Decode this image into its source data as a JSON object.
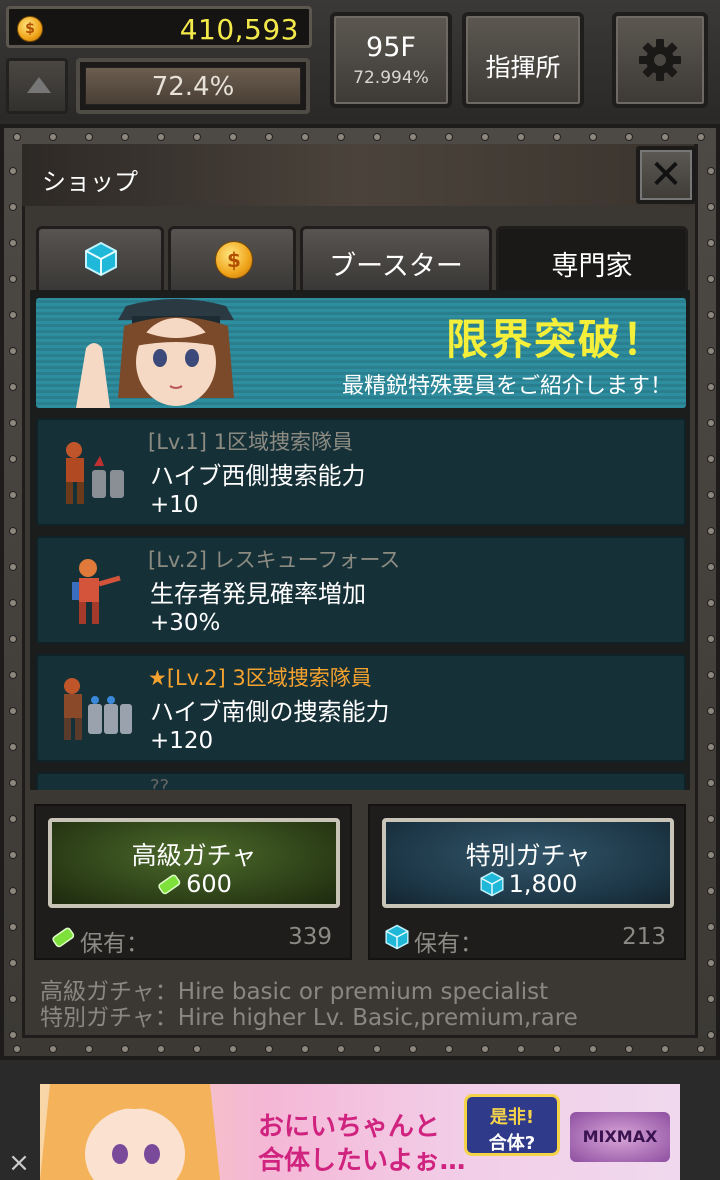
{
  "hud": {
    "coins": "410,593",
    "progress_pct": "72.4%",
    "floor": "95F",
    "floor_pct": "72.994%",
    "command_label": "指揮所"
  },
  "shop": {
    "title": "ショップ",
    "close_glyph": "✕",
    "tabs": [
      {
        "label": "",
        "icon": "cube-icon"
      },
      {
        "label": "",
        "icon": "coin-icon"
      },
      {
        "label": "ブースター",
        "icon": ""
      },
      {
        "label": "専門家",
        "icon": "",
        "active": true
      }
    ],
    "banner": {
      "title": "限界突破！",
      "subtitle": "最精鋭特殊要員をご紹介します！"
    },
    "items": [
      {
        "level": "[Lv.1] 1区域捜索隊員",
        "name": "ハイブ西側捜索能力",
        "bonus": "+10",
        "starred": false
      },
      {
        "level": "[Lv.2] レスキューフォース",
        "name": "生存者発見確率増加",
        "bonus": "+30%",
        "starred": false
      },
      {
        "level": "[Lv.2] 3区域捜索隊員",
        "name": "ハイブ南側の捜索能力",
        "bonus": "+120",
        "starred": true
      }
    ],
    "peek_level": "??",
    "gacha": {
      "premium": {
        "title": "高級ガチャ",
        "price": "600",
        "owned_label": "保有：",
        "owned": "339"
      },
      "special": {
        "title": "特別ガチャ",
        "price": "1,800",
        "owned_label": "保有：",
        "owned": "213"
      }
    },
    "descriptions": [
      "高級ガチャ：Hire basic or premium specialist",
      "特別ガチャ：Hire higher Lv. Basic,premium,rare"
    ]
  },
  "ad": {
    "line1": "おにいちゃんと",
    "line2": "合体したいよぉ…",
    "badge1": "是非!",
    "badge2": "合体?",
    "logo": "MIXMAX",
    "close": "×"
  },
  "colors": {
    "coin_text": "#f3e94a",
    "banner_title": "#f4ef3a",
    "card_bg": "#163038",
    "level_gold": "#f5a22e"
  }
}
